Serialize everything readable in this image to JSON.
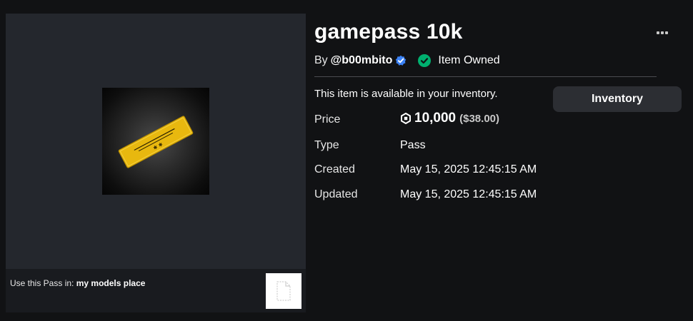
{
  "item": {
    "title": "gamepass 10k",
    "by_label": "By",
    "creator": "@b00mbito",
    "owned_text": "Item Owned",
    "availability": "This item is available in your inventory.",
    "inventory_button": "Inventory"
  },
  "details": {
    "price_label": "Price",
    "price_amount": "10,000",
    "price_usd": "($38.00)",
    "type_label": "Type",
    "type_value": "Pass",
    "created_label": "Created",
    "created_value": "May 15, 2025 12:45:15 AM",
    "updated_label": "Updated",
    "updated_value": "May 15, 2025 12:45:15 AM"
  },
  "place": {
    "prefix": "Use this Pass in:",
    "name": "my models place"
  },
  "icons": {
    "more": "more-options-icon",
    "verified": "verified-badge-icon",
    "owned": "checkmark-circle-icon",
    "currency": "robux-icon",
    "place_thumbnail": "document-placeholder-icon"
  },
  "colors": {
    "background": "#111214",
    "panel": "#24272d",
    "button": "#2c2e33",
    "owned_green": "#00b06f",
    "verified_blue": "#3b82f6",
    "pass_yellow": "#e8b80f"
  }
}
